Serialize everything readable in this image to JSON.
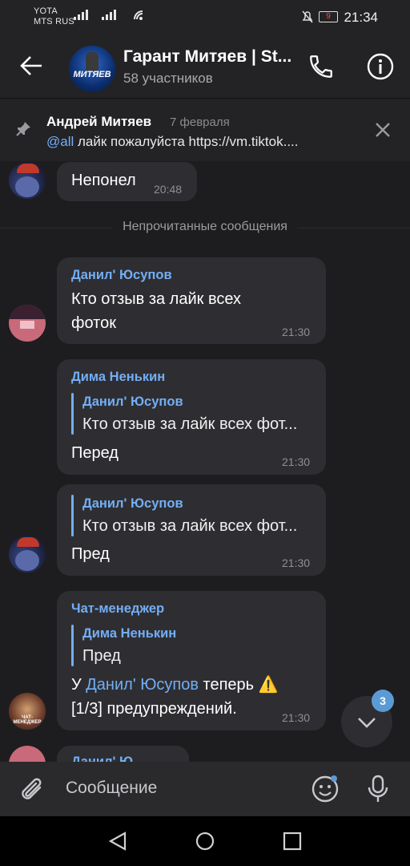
{
  "status": {
    "carrier1": "YOTA",
    "carrier2": "MTS RUS",
    "signal1": "4G",
    "battery": "9",
    "time": "21:34"
  },
  "header": {
    "title": "Гарант Митяев | St...",
    "subtitle": "58 участников",
    "avatar_text": "МИТЯЕВ"
  },
  "pinned": {
    "author": "Андрей Митяев",
    "date": "7 февраля",
    "mention": "@all",
    "text": " лайк пожалуйста https://vm.tiktok...."
  },
  "messages": {
    "m1": {
      "text": "Непонел",
      "time": "20:48"
    },
    "unread_divider": "Непрочитанные сообщения",
    "m2": {
      "sender": "Данил' Юсупов",
      "line1": "Кто отзыв за лайк всех",
      "line2": "фоток",
      "time": "21:30"
    },
    "m3": {
      "sender": "Дима Ненькин",
      "quote_name": "Данил' Юсупов",
      "quote_text": "Кто отзыв за лайк всех фот...",
      "text": "Перед",
      "time": "21:30"
    },
    "m4": {
      "quote_name": "Данил' Юсупов",
      "quote_text": "Кто отзыв за лайк всех фот...",
      "text": "Пред",
      "time": "21:30"
    },
    "m5": {
      "sender": "Чат-менеджер",
      "quote_name": "Дима Ненькин",
      "quote_text": "Пред",
      "line1_prefix": "У ",
      "line1_mention": "Данил' Юсупов",
      "line1_suffix": " теперь ⚠️",
      "line2": "[1/3] предупреждений.",
      "time": "21:30"
    },
    "m6": {
      "sender_partial": "Данил' Ю..."
    }
  },
  "scroll_badge": "3",
  "input": {
    "placeholder": "Сообщение"
  },
  "colors": {
    "accent": "#73aef5",
    "bubble": "#2e2e32",
    "background": "#1d1d1f"
  }
}
